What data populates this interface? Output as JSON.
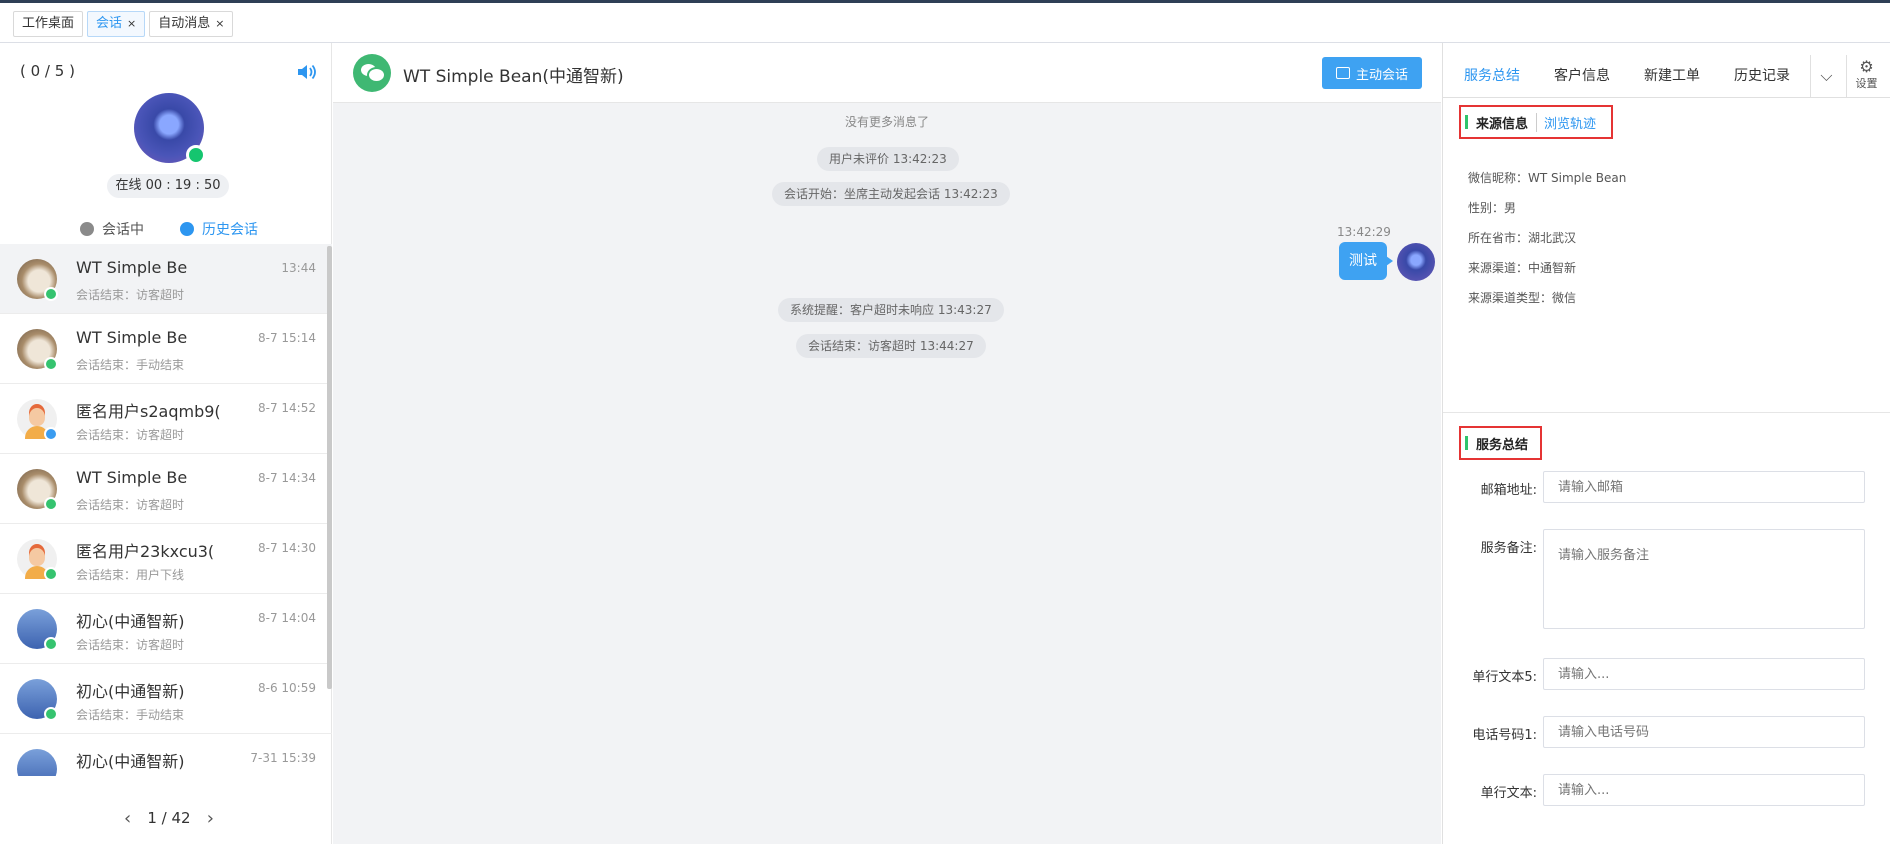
{
  "tabs": [
    {
      "label": "工作桌面",
      "close": ""
    },
    {
      "label": "会话",
      "close": "×"
    },
    {
      "label": "自动消息",
      "close": "×"
    }
  ],
  "agent": {
    "count": "( 0 / 5 )",
    "online": "在线 00 : 19 : 50"
  },
  "session_tabs": {
    "active_label": "会话中",
    "history_label": "历史会话"
  },
  "sessions": [
    {
      "name": "WT Simple Be",
      "time": "13:44",
      "status": "会话结束：访客超时"
    },
    {
      "name": "WT Simple Be",
      "time": "8-7 15:14",
      "status": "会话结束：手动结束"
    },
    {
      "name": "匿名用户s2aqmb9(",
      "time": "8-7 14:52",
      "status": "会话结束：访客超时"
    },
    {
      "name": "WT Simple Be",
      "time": "8-7 14:34",
      "status": "会话结束：访客超时"
    },
    {
      "name": "匿名用户23kxcu3(",
      "time": "8-7 14:30",
      "status": "会话结束：用户下线"
    },
    {
      "name": "初心(中通智新)",
      "time": "8-7 14:04",
      "status": "会话结束：访客超时"
    },
    {
      "name": "初心(中通智新)",
      "time": "8-6 10:59",
      "status": "会话结束：手动结束"
    },
    {
      "name": "初心(中通智新)",
      "time": "7-31 15:39",
      "status": ""
    }
  ],
  "pager": {
    "prev": "‹",
    "text": "1 / 42",
    "next": "›"
  },
  "chat": {
    "title": "WT Simple Bean(中通智新)",
    "active_button": "主动会话",
    "no_more": "没有更多消息了",
    "system_1": "用户未评价 13:42:23",
    "system_2": "会话开始：坐席主动发起会话 13:42:23",
    "msg_time": "13:42:29",
    "msg_text": "测试",
    "system_3": "系统提醒：客户超时未响应 13:43:27",
    "system_4": "会话结束：访客超时 13:44:27"
  },
  "right_tabs": {
    "tab1": "服务总结",
    "tab2": "客户信息",
    "tab3": "新建工单",
    "tab4": "历史记录",
    "dropdown": "⌵",
    "settings": "设置"
  },
  "source": {
    "title": "来源信息",
    "link": "浏览轨迹",
    "nickname": "微信昵称：WT Simple Bean",
    "gender": "性别：男",
    "city": "所在省市：湖北武汉",
    "channel": "来源渠道：中通智新",
    "channel_type": "来源渠道类型：微信"
  },
  "summary": {
    "title": "服务总结",
    "email_label": "邮箱地址:",
    "email_ph": "请输入邮箱",
    "note_label": "服务备注:",
    "note_ph": "请输入服务备注",
    "text5_label": "单行文本5:",
    "text5_ph": "请输入...",
    "phone_label": "电话号码1:",
    "phone_ph": "请输入电话号码",
    "text_label": "单行文本:",
    "text_ph": "请输入..."
  }
}
